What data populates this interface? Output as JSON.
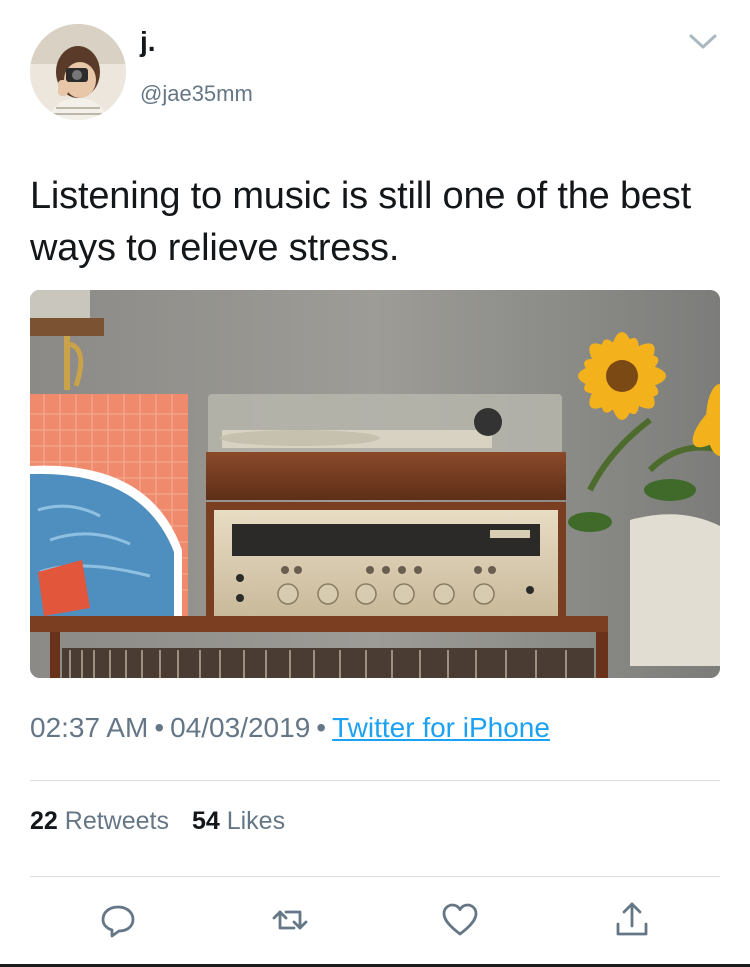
{
  "tweet": {
    "display_name": "j.",
    "handle": "@jae35mm",
    "text": "Listening to music is still one of the best ways to relieve stress.",
    "time": "02:37 AM",
    "date": "04/03/2019",
    "source": "Twitter for iPhone",
    "separator": "•"
  },
  "stats": {
    "retweets_count": "22",
    "retweets_label": "Retweets",
    "likes_count": "54",
    "likes_label": "Likes"
  },
  "actions": {
    "reply_icon": "reply-icon",
    "retweet_icon": "retweet-icon",
    "like_icon": "heart-icon",
    "share_icon": "share-icon"
  },
  "colors": {
    "link": "#1da1f2",
    "secondary_text": "#657786",
    "primary_text": "#14171a",
    "divider": "#d8dde1"
  }
}
